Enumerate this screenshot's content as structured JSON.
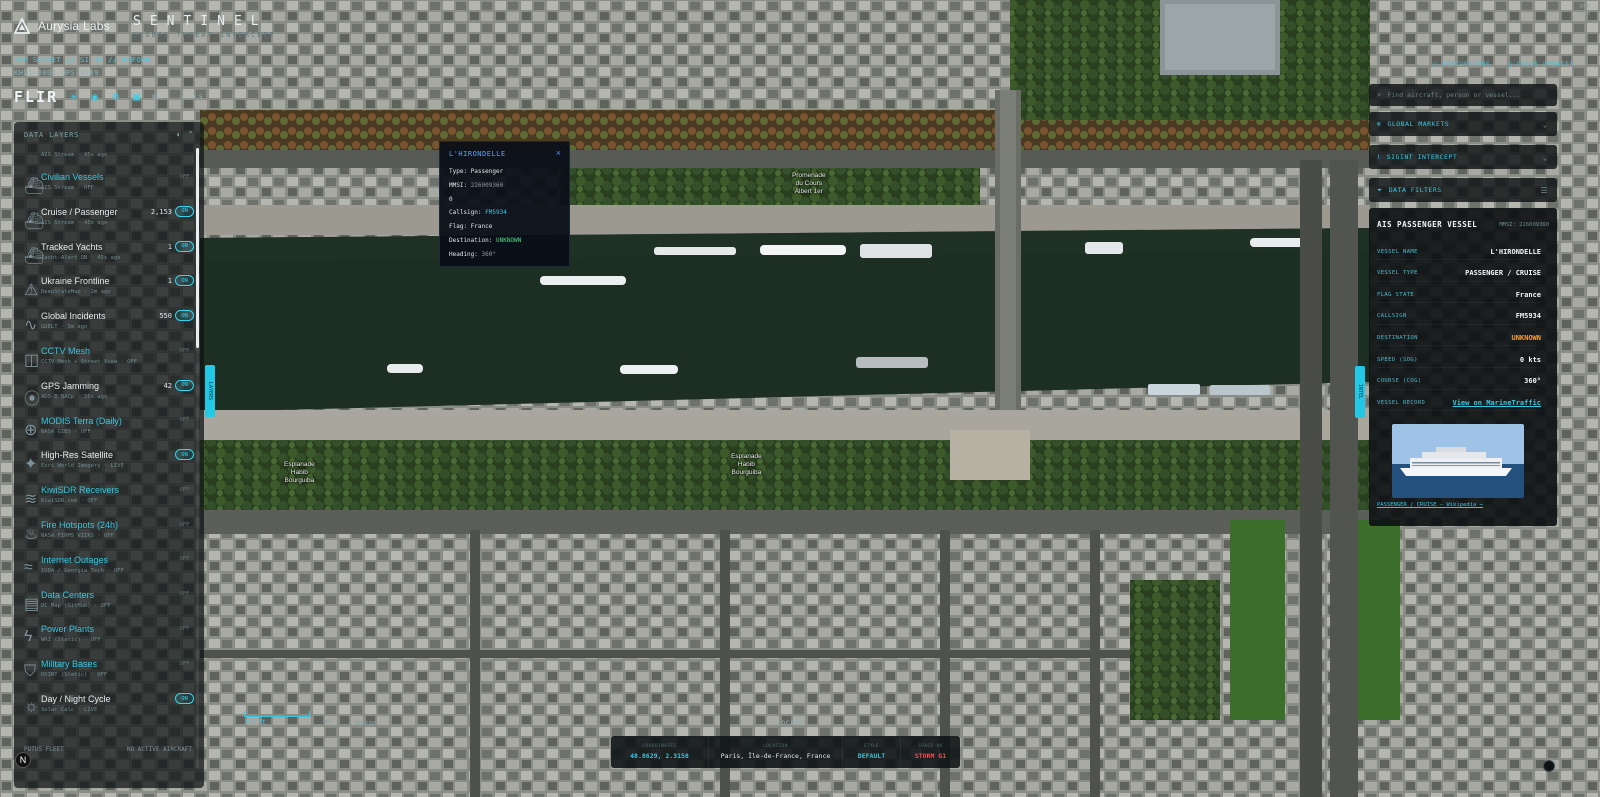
{
  "brand": {
    "name": "Aurysia Labs",
    "app": "SENTINEL",
    "subtitle": "GLOBAL THREAT INTERCEPT"
  },
  "classification": "TOP SECRET // SI-TK // NOFORN",
  "sat_id": "KH11-0004 OPS-4169",
  "mode": {
    "label": "FLIR",
    "bit_label": "BIT",
    "version": "v0.9.5"
  },
  "left_panel": {
    "title": "DATA LAYERS",
    "partial_sub": "AIS Stream · 45s ago",
    "layers": [
      {
        "name": "Civilian Vessels",
        "sub": "AIS Stream · OFF",
        "count": "",
        "state": "OFF",
        "icon": "vessel-icon",
        "active": false
      },
      {
        "name": "Cruise / Passenger",
        "sub": "AIS Stream · 45s ago",
        "count": "2,153",
        "state": "ON",
        "icon": "vessel-icon",
        "active": true
      },
      {
        "name": "Tracked Yachts",
        "sub": "Yacht-Alert DB · 45s ago",
        "count": "1",
        "state": "ON",
        "icon": "vessel-icon",
        "active": true
      },
      {
        "name": "Ukraine Frontline",
        "sub": "DeepStateMap · 2m ago",
        "count": "1",
        "state": "ON",
        "icon": "warning-icon",
        "active": true
      },
      {
        "name": "Global Incidents",
        "sub": "GDELT · 3m ago",
        "count": "550",
        "state": "ON",
        "icon": "pulse-icon",
        "active": true
      },
      {
        "name": "CCTV Mesh",
        "sub": "CCTV Mesh + Street View · OFF",
        "count": "",
        "state": "OFF",
        "icon": "camera-icon",
        "active": false
      },
      {
        "name": "GPS Jamming",
        "sub": "ADS-B NACp · 26s ago",
        "count": "42",
        "state": "ON",
        "icon": "signal-icon",
        "active": true
      },
      {
        "name": "MODIS Terra (Daily)",
        "sub": "NASA GIBS · OFF",
        "count": "",
        "state": "OFF",
        "icon": "globe-icon",
        "active": false
      },
      {
        "name": "High-Res Satellite",
        "sub": "Esri World Imagery · LIVE",
        "count": "",
        "state": "ON",
        "icon": "satellite-icon",
        "active": true
      },
      {
        "name": "KiwiSDR Receivers",
        "sub": "KiwiSDR.com · OFF",
        "count": "",
        "state": "OFF",
        "icon": "radio-icon",
        "active": false
      },
      {
        "name": "Fire Hotspots (24h)",
        "sub": "NASA FIRMS VIIRS · OFF",
        "count": "",
        "state": "OFF",
        "icon": "flame-icon",
        "active": false
      },
      {
        "name": "Internet Outages",
        "sub": "IODA / Georgia Tech · OFF",
        "count": "",
        "state": "OFF",
        "icon": "wifi-icon",
        "active": false
      },
      {
        "name": "Data Centers",
        "sub": "DC Map (GitHub) · OFF",
        "count": "",
        "state": "OFF",
        "icon": "server-icon",
        "active": false
      },
      {
        "name": "Power Plants",
        "sub": "WRI (Static) · OFF",
        "count": "",
        "state": "OFF",
        "icon": "bolt-icon",
        "active": false
      },
      {
        "name": "Military Bases",
        "sub": "OSINT (Static) · OFF",
        "count": "",
        "state": "OFF",
        "icon": "shield-icon",
        "active": false
      },
      {
        "name": "Day / Night Cycle",
        "sub": "Solar Calc · LIVE",
        "count": "",
        "state": "ON",
        "icon": "sun-icon",
        "active": true
      }
    ],
    "potus_label": "POTUS FLEET",
    "potus_status": "NO ACTIVE AIRCRAFT",
    "n_button": "N"
  },
  "side_tabs": {
    "left": "LAYERS",
    "right": "INTEL"
  },
  "popup": {
    "title": "L'HIRONDELLE",
    "close": "×",
    "type_label": "Type:",
    "type_value": "Passenger",
    "mmsi_label": "MMSI:",
    "mmsi_value": "226009360",
    "extra_value": "0",
    "callsign_label": "Callsign:",
    "callsign_value": "FM5934",
    "flag_label": "Flag:",
    "flag_value": "France",
    "dest_label": "Destination:",
    "dest_value": "UNKNOWN",
    "heading_label": "Heading:",
    "heading_value": "360°"
  },
  "map_labels": {
    "promenade": [
      "Promenade",
      "du Cours",
      "Albert 1er"
    ],
    "esplanade_left": [
      "Esplanade",
      "Habib",
      "Bourguiba"
    ],
    "esplanade_mid": [
      "Esplanade",
      "Habib",
      "Bourguiba"
    ]
  },
  "top_right": {
    "discussions": "DISCUSSIONS",
    "check_updates": "CHECK UPDATES",
    "corner_line1": "RTX",
    "corner_line2": "v10"
  },
  "search": {
    "placeholder": "Find aircraft, person or vessel..."
  },
  "sections": {
    "global_markets": "GLOBAL MARKETS",
    "sigint_intercept": "SIGINT INTERCEPT",
    "data_filters": "DATA FILTERS"
  },
  "vessel": {
    "title": "AIS PASSENGER VESSEL",
    "mmsi": "MMSI: 226009360",
    "rows": [
      {
        "k": "VESSEL NAME",
        "v": "L'HIRONDELLE",
        "style": ""
      },
      {
        "k": "VESSEL TYPE",
        "v": "PASSENGER / CRUISE",
        "style": ""
      },
      {
        "k": "FLAG STATE",
        "v": "France",
        "style": ""
      },
      {
        "k": "CALLSIGN",
        "v": "FM5934",
        "style": ""
      },
      {
        "k": "DESTINATION",
        "v": "UNKNOWN",
        "style": "orange"
      },
      {
        "k": "SPEED (SOG)",
        "v": "0 kts",
        "style": ""
      },
      {
        "k": "COURSE (COG)",
        "v": "360°",
        "style": ""
      },
      {
        "k": "VESSEL RECORD",
        "v": "View on MarineTraffic",
        "style": "link"
      }
    ],
    "wiki_link": "PASSENGER / CRUISE — Wikipedia →"
  },
  "bottom": {
    "scale_ft": "317 ft",
    "scale_mi": "mi",
    "measure": "MEASURE",
    "locate": "LOCATE",
    "status": [
      {
        "k": "COORDINATES",
        "v": "48.8629, 2.3158",
        "style": ""
      },
      {
        "k": "LOCATION",
        "v": "Paris, Île-de-France, France",
        "style": "white"
      },
      {
        "k": "STYLE",
        "v": "DEFAULT",
        "style": ""
      },
      {
        "k": "SPACE WX",
        "v": "STORM G1",
        "style": "red"
      }
    ]
  },
  "colors": {
    "accent": "#33d5f0",
    "water": "#1d2e23",
    "alert": "#ff4b4b",
    "warning": "#ff9c2a"
  }
}
